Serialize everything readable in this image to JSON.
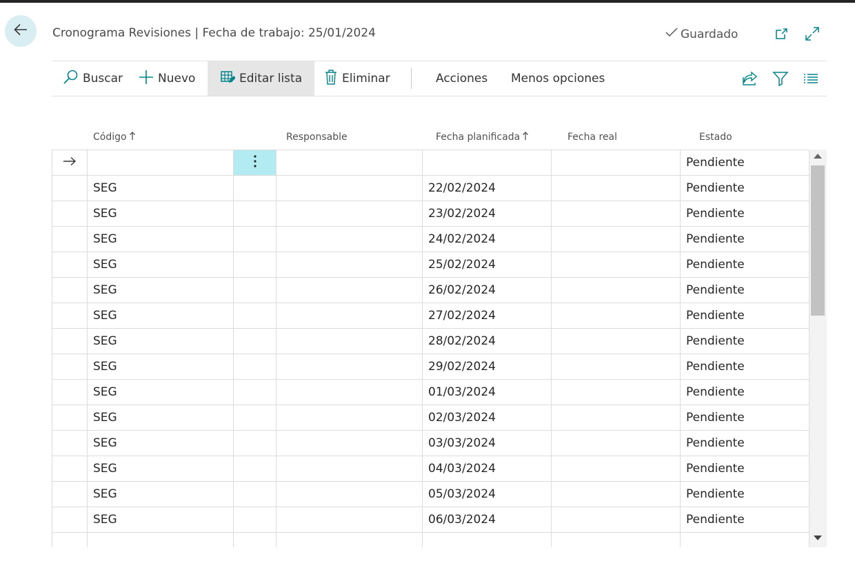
{
  "colors": {
    "accent": "#008489",
    "back_bg": "#d9eef2",
    "selected_cell": "#b2ebf2"
  },
  "header": {
    "title": "Cronograma Revisiones | Fecha de trabajo: 25/01/2024",
    "saved_label": "Guardado",
    "icons": [
      "back-arrow-icon",
      "checkmark-icon",
      "open-new-window-icon",
      "expand-icon"
    ]
  },
  "actions": {
    "search": "Buscar",
    "new": "Nuevo",
    "edit_list": "Editar lista",
    "delete": "Eliminar",
    "actions": "Acciones",
    "fewer_options": "Menos opciones",
    "icons": [
      "share-icon",
      "filter-icon",
      "list-view-icon"
    ]
  },
  "table": {
    "columns": {
      "code": "Código",
      "responsible": "Responsable",
      "planned_date": "Fecha planificada",
      "actual_date": "Fecha real",
      "status": "Estado"
    },
    "rows": [
      {
        "code": "",
        "planned_date": "",
        "status": "Pendiente"
      },
      {
        "code": "SEG",
        "planned_date": "22/02/2024",
        "status": "Pendiente"
      },
      {
        "code": "SEG",
        "planned_date": "23/02/2024",
        "status": "Pendiente"
      },
      {
        "code": "SEG",
        "planned_date": "24/02/2024",
        "status": "Pendiente"
      },
      {
        "code": "SEG",
        "planned_date": "25/02/2024",
        "status": "Pendiente"
      },
      {
        "code": "SEG",
        "planned_date": "26/02/2024",
        "status": "Pendiente"
      },
      {
        "code": "SEG",
        "planned_date": "27/02/2024",
        "status": "Pendiente"
      },
      {
        "code": "SEG",
        "planned_date": "28/02/2024",
        "status": "Pendiente"
      },
      {
        "code": "SEG",
        "planned_date": "29/02/2024",
        "status": "Pendiente"
      },
      {
        "code": "SEG",
        "planned_date": "01/03/2024",
        "status": "Pendiente"
      },
      {
        "code": "SEG",
        "planned_date": "02/03/2024",
        "status": "Pendiente"
      },
      {
        "code": "SEG",
        "planned_date": "03/03/2024",
        "status": "Pendiente"
      },
      {
        "code": "SEG",
        "planned_date": "04/03/2024",
        "status": "Pendiente"
      },
      {
        "code": "SEG",
        "planned_date": "05/03/2024",
        "status": "Pendiente"
      },
      {
        "code": "SEG",
        "planned_date": "06/03/2024",
        "status": "Pendiente"
      }
    ]
  }
}
